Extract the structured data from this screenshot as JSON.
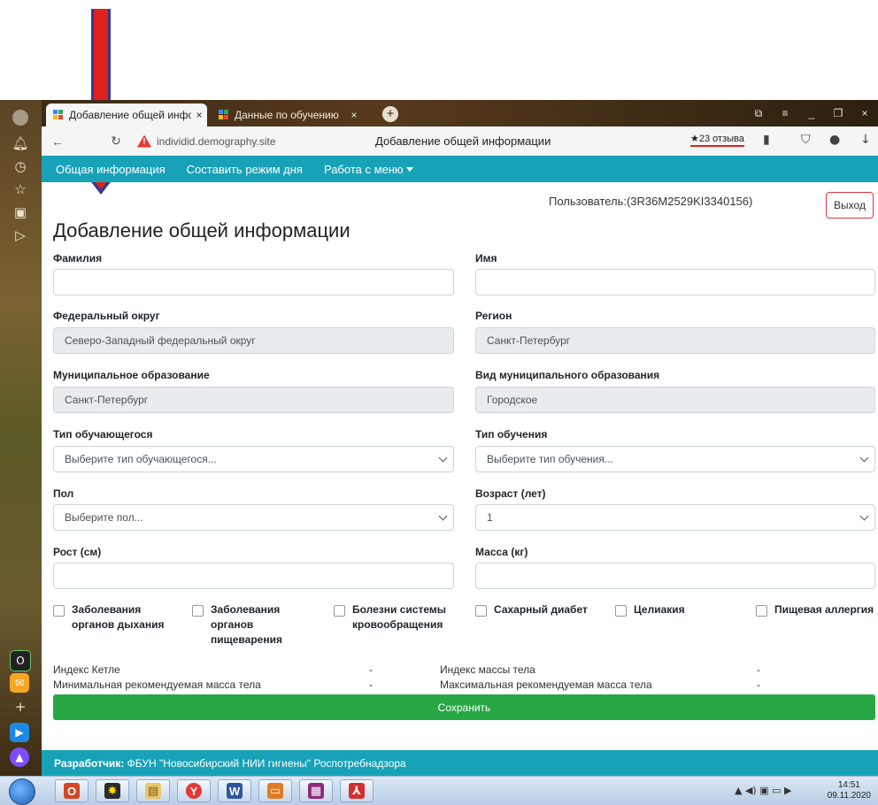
{
  "browser": {
    "tabs": [
      {
        "label": "Добавление общей инфор",
        "close": "×"
      },
      {
        "label": "Данные по обучению",
        "close": "×"
      }
    ],
    "new_tab": "+",
    "window_buttons": [
      "⧉",
      "≡",
      "_",
      "❐",
      "×"
    ],
    "address": {
      "domain": "individid.demography.site",
      "page_title": "Добавление общей информации",
      "reviews": "★23 отзыва"
    }
  },
  "sitenav": {
    "items": [
      "Общая информация",
      "Составить режим дня",
      "Работа с меню"
    ]
  },
  "header": {
    "user": "Пользователь:(3R36M2529KI3340156)",
    "logout": "Выход",
    "title": "Добавление общей информации"
  },
  "form": {
    "surname": {
      "label": "Фамилия",
      "value": ""
    },
    "name": {
      "label": "Имя",
      "value": ""
    },
    "federal_district": {
      "label": "Федеральный округ",
      "value": "Северо-Западный федеральный округ"
    },
    "region": {
      "label": "Регион",
      "value": "Санкт-Петербург"
    },
    "municipality": {
      "label": "Муниципальное образование",
      "value": "Санкт-Петербург"
    },
    "municipality_type": {
      "label": "Вид муниципального образования",
      "value": "Городское"
    },
    "student_type": {
      "label": "Тип обучающегося",
      "value": "Выберите тип обучающегося..."
    },
    "study_type": {
      "label": "Тип обучения",
      "value": "Выберите тип обучения..."
    },
    "sex": {
      "label": "Пол",
      "value": "Выберите пол..."
    },
    "age": {
      "label": "Возраст (лет)",
      "value": "1"
    },
    "height": {
      "label": "Рост (см)",
      "value": ""
    },
    "weight": {
      "label": "Масса (кг)",
      "value": ""
    },
    "diseases": [
      {
        "line1": "Заболевания",
        "line2": "органов дыхания",
        "line3": ""
      },
      {
        "line1": "Заболевания",
        "line2": "органов",
        "line3": "пищеварения"
      },
      {
        "line1": "Болезни системы",
        "line2": "кровообращения",
        "line3": ""
      },
      {
        "line1": "Сахарный диабет",
        "line2": "",
        "line3": ""
      },
      {
        "line1": "Целиакия",
        "line2": "",
        "line3": ""
      },
      {
        "line1": "Пищевая аллергия",
        "line2": "",
        "line3": ""
      }
    ]
  },
  "indices": {
    "ketle": {
      "label": "Индекс Кетле",
      "value": "-"
    },
    "bmi": {
      "label": "Индекс массы тела",
      "value": "-"
    },
    "min_mass": {
      "label": "Минимальная рекомендуемая масса тела",
      "value": "-"
    },
    "max_mass": {
      "label": "Максимальная рекомендуемая масса тела",
      "value": "-"
    }
  },
  "save_label": "Сохранить",
  "footer": {
    "prefix": "Разработчик:",
    "text": " ФБУН \"Новосибирский НИИ гигиены\" Роспотребнадзора"
  },
  "taskbar": {
    "time": "14:51",
    "date": "09.11.2020"
  },
  "colors": {
    "accent": "#17a2b8",
    "save": "#28a745",
    "logout_border": "#dc3545",
    "annotation_arrow": "#e0201c"
  }
}
